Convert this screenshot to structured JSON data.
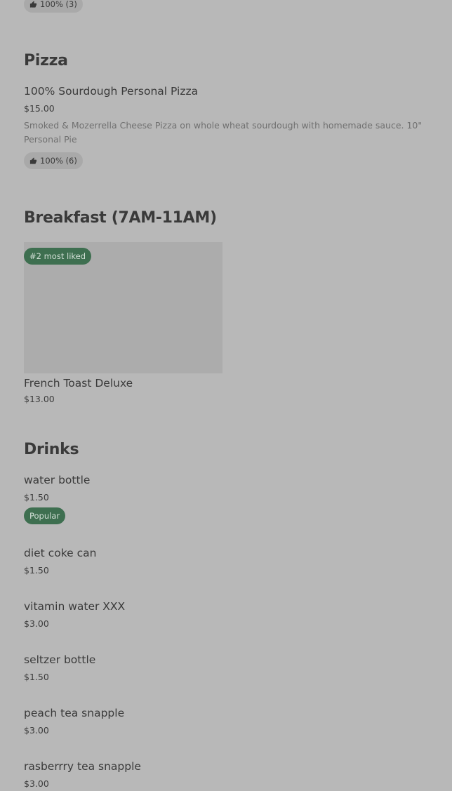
{
  "top_partial": {
    "like_text": "100% (3)"
  },
  "sections": {
    "pizza": {
      "title": "Pizza",
      "item": {
        "name": "100% Sourdough Personal Pizza",
        "price": "$15.00",
        "description": "Smoked & Mozerrella Cheese Pizza on whole wheat sourdough with homemade sauce. 10\" Personal Pie",
        "like_text": "100% (6)"
      }
    },
    "breakfast": {
      "title": "Breakfast (7AM-11AM)",
      "item": {
        "badge": "#2 most liked",
        "name": "French Toast Deluxe",
        "price": "$13.00"
      }
    },
    "drinks": {
      "title": "Drinks",
      "items": [
        {
          "name": "water bottle",
          "price": "$1.50",
          "badge": "Popular"
        },
        {
          "name": "diet coke can",
          "price": "$1.50"
        },
        {
          "name": "vitamin water XXX",
          "price": "$3.00"
        },
        {
          "name": "seltzer bottle",
          "price": "$1.50"
        },
        {
          "name": "peach tea snapple",
          "price": "$3.00"
        },
        {
          "name": "rasberrry tea snapple",
          "price": "$3.00"
        }
      ]
    }
  },
  "icons": {
    "like": "thumbs-up-icon"
  },
  "colors": {
    "background": "#b8b8b8",
    "badge_green": "#3e6f50",
    "pill_gray": "#a9a9a9",
    "text": "#3a3a3a"
  }
}
